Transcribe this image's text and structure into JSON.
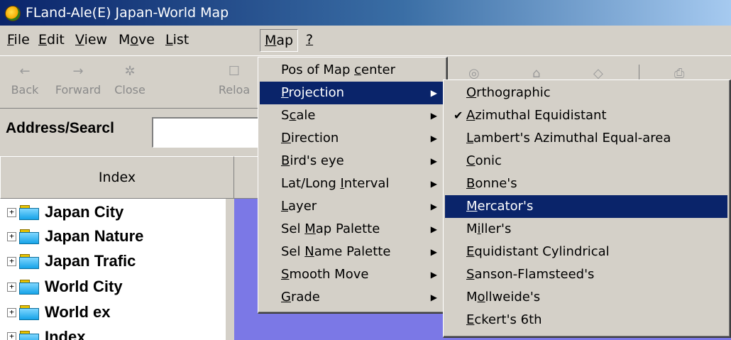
{
  "window": {
    "title": "FLand-Ale(E) Japan-World Map"
  },
  "menubar": [
    {
      "label": "File"
    },
    {
      "label": "Edit"
    },
    {
      "label": "View"
    },
    {
      "label": "Move"
    },
    {
      "label": "List"
    },
    {
      "label": "Map"
    },
    {
      "label": "?"
    }
  ],
  "toolbar": {
    "back": "Back",
    "forward": "Forward",
    "close": "Close",
    "reload": "Reloa"
  },
  "address": {
    "label": "Address/Searcl",
    "value": ""
  },
  "index": {
    "header": "Index"
  },
  "tree": [
    {
      "label": "Japan City"
    },
    {
      "label": "Japan Nature"
    },
    {
      "label": "Japan Trafic"
    },
    {
      "label": "World City"
    },
    {
      "label": "World ex"
    },
    {
      "label": "Index"
    }
  ],
  "map_menu": [
    {
      "label": "Pos of Map center"
    },
    {
      "label": "Projection"
    },
    {
      "label": "Scale"
    },
    {
      "label": "Direction"
    },
    {
      "label": "Bird's eye"
    },
    {
      "label": "Lat/Long Interval"
    },
    {
      "label": "Layer"
    },
    {
      "label": "Sel Map Palette"
    },
    {
      "label": "Sel Name Palette"
    },
    {
      "label": "Smooth Move"
    },
    {
      "label": "Grade"
    }
  ],
  "projection_menu": [
    {
      "label": "Orthographic"
    },
    {
      "label": "Azimuthal Equidistant",
      "checked": true
    },
    {
      "label": "Lambert's Azimuthal Equal-area"
    },
    {
      "label": "Conic"
    },
    {
      "label": "Bonne's"
    },
    {
      "label": "Mercator's"
    },
    {
      "label": "Miller's"
    },
    {
      "label": "Equidistant Cylindrical"
    },
    {
      "label": "Sanson-Flamsteed's"
    },
    {
      "label": "Mollweide's"
    },
    {
      "label": "Eckert's 6th"
    }
  ],
  "colors": {
    "highlight": "#0a246a",
    "map_background": "#7b78e6",
    "face": "#d4d0c8"
  }
}
